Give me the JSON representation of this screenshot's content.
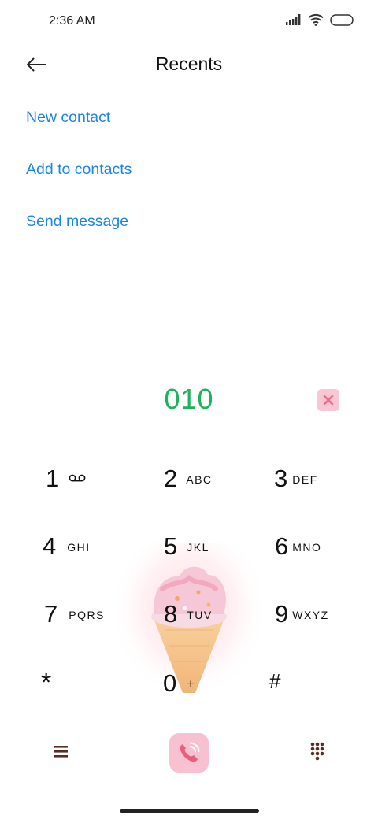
{
  "status_bar": {
    "time": "2:36 AM",
    "icons": [
      "signal-icon",
      "wifi-icon",
      "battery-icon"
    ]
  },
  "header": {
    "title": "Recents",
    "back_icon": "back-arrow-icon"
  },
  "actions": [
    {
      "label": "New contact"
    },
    {
      "label": "Add to contacts"
    },
    {
      "label": "Send message"
    }
  ],
  "dialer": {
    "number": "010",
    "delete_icon": "close-x-icon"
  },
  "keypad": [
    {
      "digit": "1",
      "letters": "",
      "extra_icon": "voicemail-icon"
    },
    {
      "digit": "2",
      "letters": "ABC"
    },
    {
      "digit": "3",
      "letters": "DEF"
    },
    {
      "digit": "4",
      "letters": "GHI"
    },
    {
      "digit": "5",
      "letters": "JKL"
    },
    {
      "digit": "6",
      "letters": "MNO"
    },
    {
      "digit": "7",
      "letters": "PQRS"
    },
    {
      "digit": "8",
      "letters": "TUV"
    },
    {
      "digit": "9",
      "letters": "WXYZ"
    },
    {
      "digit": "*",
      "letters": ""
    },
    {
      "digit": "0",
      "letters": "+"
    },
    {
      "digit": "#",
      "letters": ""
    }
  ],
  "bottom_bar": {
    "menu_icon": "menu-icon",
    "call_icon": "phone-call-icon",
    "dialpad_icon": "dialpad-icon"
  },
  "colors": {
    "link": "#1a86e8",
    "number": "#1fb25a",
    "accent_pink": "#f8c1d1"
  }
}
